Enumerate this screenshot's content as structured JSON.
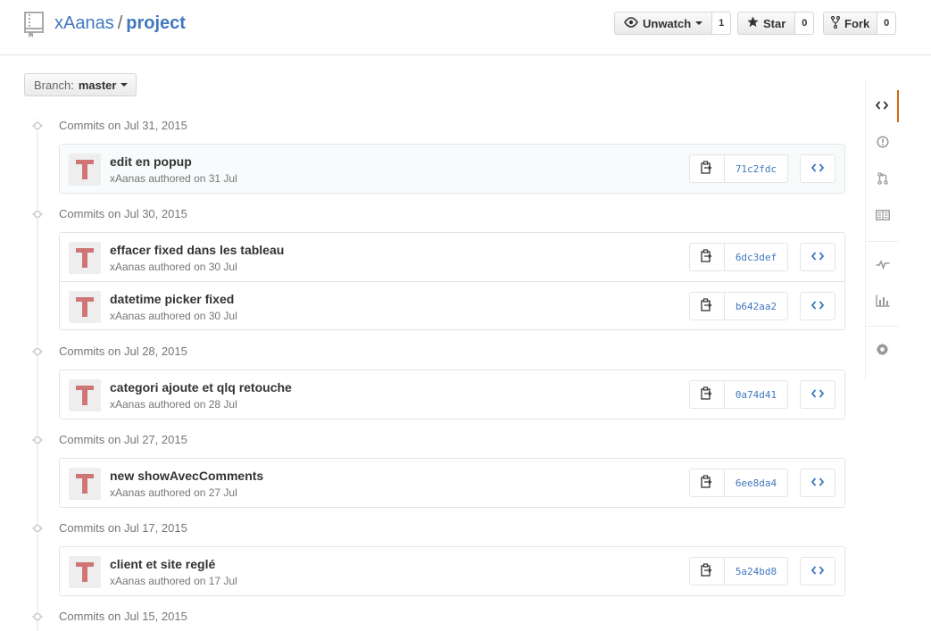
{
  "repo": {
    "owner": "xAanas",
    "separator": "/",
    "name": "project"
  },
  "actions": {
    "watch": {
      "label": "Unwatch",
      "count": "1"
    },
    "star": {
      "label": "Star",
      "count": "0"
    },
    "fork": {
      "label": "Fork",
      "count": "0"
    }
  },
  "branch": {
    "label": "Branch:",
    "value": "master"
  },
  "groups": [
    {
      "title": "Commits on Jul 31, 2015",
      "commits": [
        {
          "message": "edit en popup",
          "meta": "xAanas authored on 31 Jul",
          "sha": "71c2fdc"
        }
      ]
    },
    {
      "title": "Commits on Jul 30, 2015",
      "commits": [
        {
          "message": "effacer fixed dans les tableau",
          "meta": "xAanas authored on 30 Jul",
          "sha": "6dc3def"
        },
        {
          "message": "datetime picker fixed",
          "meta": "xAanas authored on 30 Jul",
          "sha": "b642aa2"
        }
      ]
    },
    {
      "title": "Commits on Jul 28, 2015",
      "commits": [
        {
          "message": "categori ajoute et qlq retouche",
          "meta": "xAanas authored on 28 Jul",
          "sha": "0a74d41"
        }
      ]
    },
    {
      "title": "Commits on Jul 27, 2015",
      "commits": [
        {
          "message": "new showAvecComments",
          "meta": "xAanas authored on 27 Jul",
          "sha": "6ee8da4"
        }
      ]
    },
    {
      "title": "Commits on Jul 17, 2015",
      "commits": [
        {
          "message": "client et site reglé",
          "meta": "xAanas authored on 17 Jul",
          "sha": "5a24bd8"
        }
      ]
    },
    {
      "title": "Commits on Jul 15, 2015",
      "commits": []
    }
  ],
  "nav": [
    "code-icon",
    "issue-icon",
    "pull-request-icon",
    "wiki-icon",
    "pulse-icon",
    "graph-icon",
    "settings-icon"
  ],
  "colors": {
    "link": "#4078c0",
    "avatar": "#d07575",
    "nav_selected": "#d26911"
  }
}
